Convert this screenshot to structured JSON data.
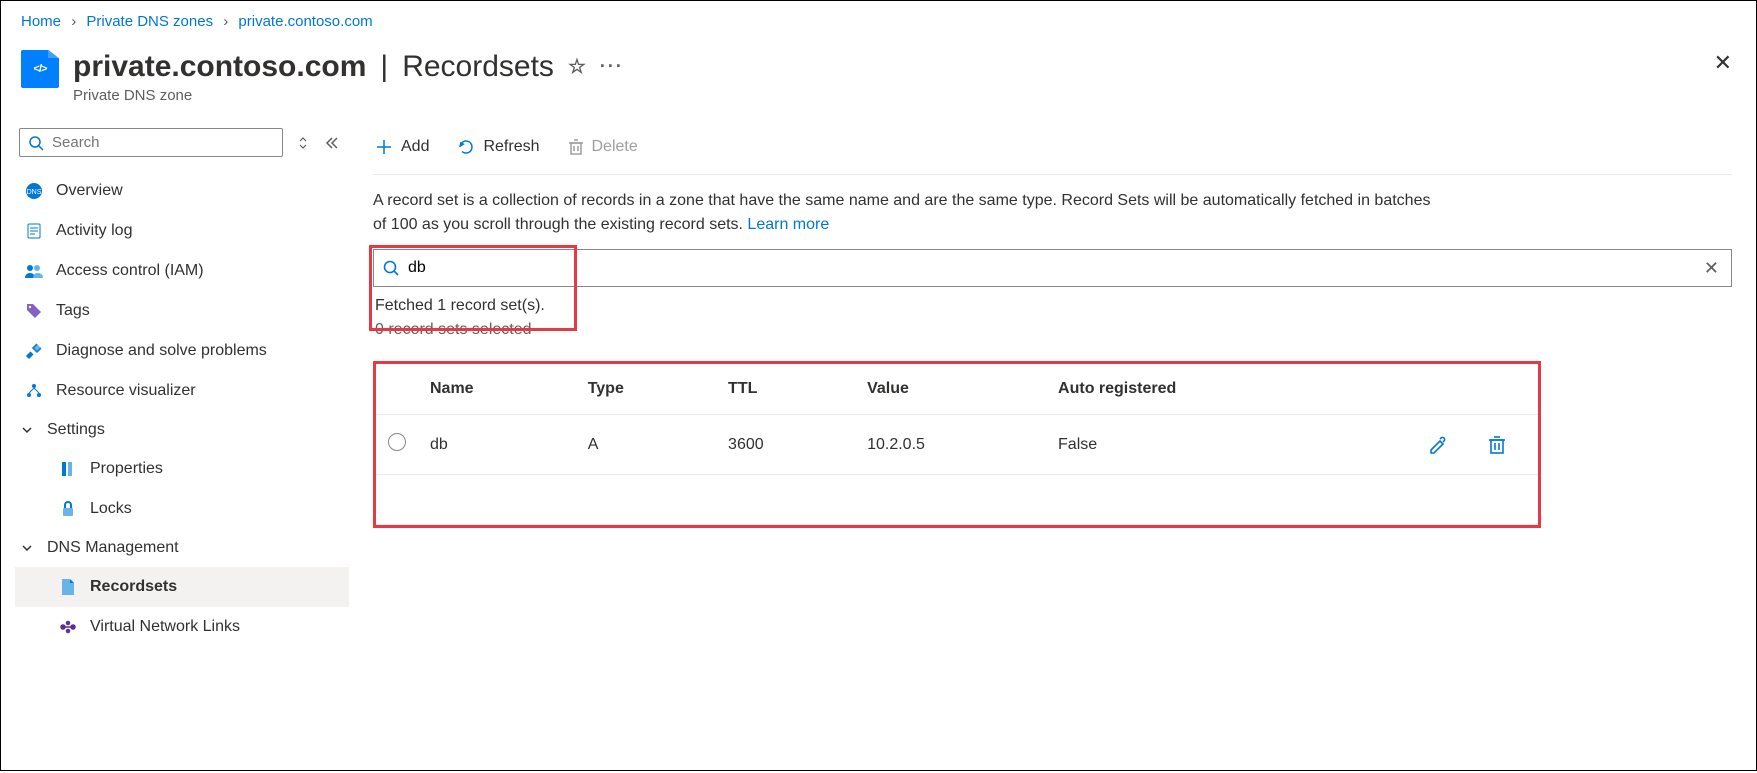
{
  "breadcrumb": {
    "items": [
      "Home",
      "Private DNS zones",
      "private.contoso.com"
    ]
  },
  "header": {
    "title": "private.contoso.com",
    "section": "Recordsets",
    "subtitle": "Private DNS zone"
  },
  "sidebar": {
    "search_placeholder": "Search",
    "items": {
      "overview": "Overview",
      "activity_log": "Activity log",
      "access_control": "Access control (IAM)",
      "tags": "Tags",
      "diagnose": "Diagnose and solve problems",
      "resource_visualizer": "Resource visualizer"
    },
    "settings_label": "Settings",
    "settings_items": {
      "properties": "Properties",
      "locks": "Locks"
    },
    "dns_label": "DNS Management",
    "dns_items": {
      "recordsets": "Recordsets",
      "vnl": "Virtual Network Links"
    }
  },
  "toolbar": {
    "add": "Add",
    "refresh": "Refresh",
    "delete": "Delete"
  },
  "description": {
    "text": "A record set is a collection of records in a zone that have the same name and are the same type. Record Sets will be automatically fetched in batches of 100 as you scroll through the existing record sets. ",
    "learn_more": "Learn more"
  },
  "records_search": {
    "value": "db"
  },
  "status": {
    "fetched": "Fetched 1 record set(s).",
    "selected": "0 record sets selected"
  },
  "table": {
    "headers": {
      "name": "Name",
      "type": "Type",
      "ttl": "TTL",
      "value": "Value",
      "auto": "Auto registered"
    },
    "rows": [
      {
        "name": "db",
        "type": "A",
        "ttl": "3600",
        "value": "10.2.0.5",
        "auto": "False"
      }
    ]
  }
}
